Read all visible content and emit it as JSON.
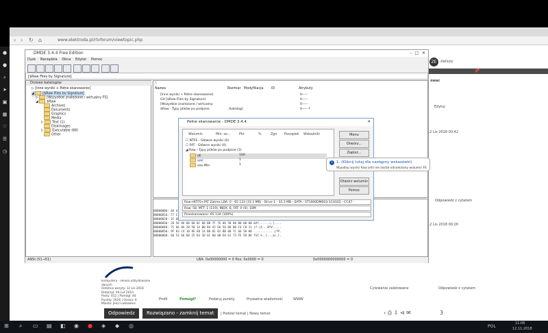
{
  "browser": {
    "url": "www.elektroda.pl/rtvforum/viewtopic.php",
    "right_username": "zieliuzy"
  },
  "avatar_initials": "ZE",
  "dmde": {
    "title": "DMDE 3.4.4 Free Edition",
    "menu": [
      "Dysk",
      "Narzędzia",
      "Okna",
      "Edytor",
      "Pomoc"
    ],
    "path": "[$Raw Files by Signature]",
    "tree_header": "Drzewo katalogów",
    "tree": [
      "[Inne wyniki + Pełne skanowanie]",
      "[$Raw Files by Signature]",
      "[Wszystkie znalezione / wirtualny FS]",
      "$Raw",
      "Archives",
      "Documents",
      "Graphics",
      "Media",
      "Text (1)",
      "Diskimages",
      "Executable (68)",
      "Other"
    ],
    "list_path": "\\",
    "list_cols": [
      "Nazwa",
      "Rozmiar",
      "Modyfikacja",
      "ID",
      "Atrybuty"
    ],
    "list_rows": [
      {
        "name": "[Inne wyniki + Pełne skanowanie]",
        "size": "",
        "attr": "0-----"
      },
      {
        "name": "Git [$Raw Files by Signature]",
        "size": "",
        "attr": "0-----"
      },
      {
        "name": "[Wszystkie znalezione / wirtualny",
        "size": "",
        "attr": "0-----"
      },
      {
        "name": "$Raw - Typy plików po podpisie",
        "size": "[katalog]",
        "attr": "0-----  f"
      }
    ],
    "hex_rows": [
      "00000000: 84 41 86 A6 55 CD 13 5B  72 0E 91 F0 56 A6 7A 09  .A..U..[r...V.z.",
      "00000010: F7 C1 B1 0B 74 E8 FE 46  1B 66 E0 0D 3E 1B 00 74  ....t..F.f..>..t",
      "00000020: 1F 66 FF 06 11 00 03 16  0F 00 83 D2 00 00 7E 89  .f............~.",
      "00000030: 26 56 66 00 00 0C 00 BB  7F 7E 06 5B 00 B0 00 00  &Vf......~.[....",
      "00000040: 7C 66 8A 28 58 1A B0 B4  42 66 56 00 B0 F4 C8 11  |f.(X...BfV.....",
      "00000050: 9F 83 C4 10 9E EB 14 B0  01 02 BB 00 7C 66 50 00  ............|fP.",
      "00000060: 66 53 66 D0 25 03 1D 6C  00 00 E8 61 73 FE 5D 88  fSf.%..l...as.]."
    ],
    "status_left": "ANSI (51→51)",
    "status_mid": "LBA: 0x00000000 = 0  Pos: 0x0000 = 0",
    "status_right": "0x0000000000000 = 0"
  },
  "dialog": {
    "title": "Pełne skanowanie - DMDE 3.4.4",
    "cols": [
      "Wolumin",
      "Min. so...",
      "Pkt",
      "%",
      "Zgo",
      "Początek",
      "Wskaźniki"
    ],
    "rows": [
      {
        "label": "NTFS - Główne wyniki (0)",
        "v": ""
      },
      {
        "label": "FAT - Główne wyniki (0)",
        "v": ""
      },
      {
        "label": "Raw - Typy plików po podpisie (3)",
        "v": ""
      },
      {
        "label": "dll",
        "v": "100"
      },
      {
        "label": "xml",
        "v": "1"
      },
      {
        "label": "exe-Win",
        "v": "1"
      }
    ],
    "buttons": [
      "Menu",
      "Otwórz...",
      "Zapisz...",
      "Otwórz wolumin",
      "Pomoc"
    ],
    "info1": "Raw+NTFS+FAT Zakres LBA: 0 - 65 133 (33.3 MB) - Drive 1 - 33.3 MB - SATA - ST1000DM003-1CH162 - CC47 - Z1D4ZZ7C",
    "info2": "Raw: 58, MFT: 1 (119), INDX: 6, FAT: 0 (0), 18M",
    "progress": "Przeskanowano: 65 134 (100%)"
  },
  "tooltip": {
    "title": "1. (Kliknij tutaj dla następny wskazówki)",
    "text": "Wyjobluj wyniki Raw jeśli nie został odnaleziony wolumin FS"
  },
  "forum": {
    "heading_fragment": "owac",
    "edit": "Edytuj",
    "date1": "12 Lis 2018 00:42",
    "date2": "12 Lis 2018 00:26",
    "quote": "Odpowiedz z cytatem",
    "user_info": [
      "komputery - serwis,odzyskiwanie",
      "danych",
      "Ostatnio wszyty: 12 Lis 2018",
      "Dołączył: 04 Lut 2010",
      "Posty: 452 | Pomógł: 44",
      "Punkty: 1626 | Ocena: 6",
      "Miasto: Jelcz Laskowice"
    ],
    "actions": [
      "Profil",
      "Pomógł?",
      "Podaruj punkty",
      "Prywatna wiadomość",
      "WWW"
    ],
    "recommend": "Cytowanie zaletowane",
    "reply": "Odpowiedz",
    "solved": "Rozwiązano - zamknij temat",
    "links": "| Podziel temat | Nowy temat",
    "page_no": "3"
  },
  "taskbar": {
    "time": "11:06",
    "date": "12.11.2018",
    "lang": "POL"
  }
}
